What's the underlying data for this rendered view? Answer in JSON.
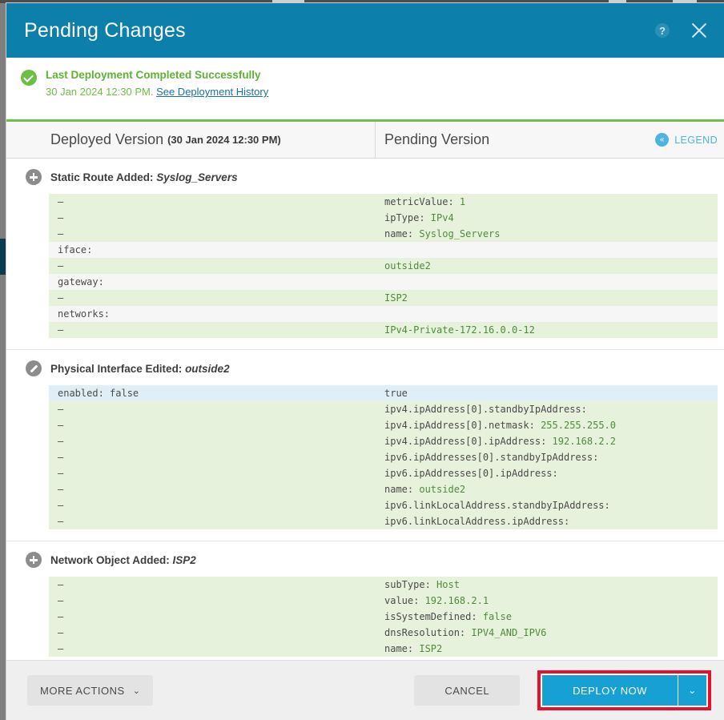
{
  "background": {
    "accent_blue": "#0d7fab",
    "success_green": "#6cbe45",
    "highlight_red": "#e8112d",
    "deploy_blue": "#17a0d4"
  },
  "titlebar": {
    "title": "Pending Changes",
    "help_icon": "help-circle-icon",
    "help_glyph": "?",
    "close_icon": "close-icon"
  },
  "banner": {
    "status_icon": "success-check-icon",
    "title": "Last Deployment Completed Successfully",
    "timestamp": "30 Jan 2024 12:30 PM.",
    "link_label": "See Deployment History"
  },
  "columns": {
    "deployed_label": "Deployed Version",
    "deployed_timestamp": "(30 Jan 2024 12:30 PM)",
    "pending_label": "Pending Version",
    "legend_label": "LEGEND",
    "legend_icon": "double-chevron-left-icon",
    "legend_glyph": "«"
  },
  "blocks": [
    {
      "icon": "plus-circle-icon",
      "icon_type": "plus",
      "title_prefix": "Static Route Added:",
      "title_name": "Syslog_Servers",
      "rows": [
        {
          "type": "added",
          "left": "–",
          "right_key": "metricValue:",
          "right_val": "1",
          "val_color": "green"
        },
        {
          "type": "added",
          "left": "–",
          "right_key": "ipType:",
          "right_val": "IPv4",
          "val_color": "green"
        },
        {
          "type": "added",
          "left": "–",
          "right_key": "name:",
          "right_val": "Syslog_Servers",
          "val_color": "green"
        },
        {
          "type": "neutral",
          "left": "iface:",
          "right_key": "",
          "right_val": "",
          "val_color": "green"
        },
        {
          "type": "added",
          "left": "–",
          "right_key": "",
          "right_val": "outside2",
          "val_color": "green"
        },
        {
          "type": "neutral",
          "left": "gateway:",
          "right_key": "",
          "right_val": "",
          "val_color": "green"
        },
        {
          "type": "added",
          "left": "–",
          "right_key": "",
          "right_val": "ISP2",
          "val_color": "green"
        },
        {
          "type": "neutral",
          "left": "networks:",
          "right_key": "",
          "right_val": "",
          "val_color": "green"
        },
        {
          "type": "added",
          "left": "–",
          "right_key": "",
          "right_val": "IPv4-Private-172.16.0.0-12",
          "val_color": "green"
        }
      ]
    },
    {
      "icon": "pencil-circle-icon",
      "icon_type": "pencil",
      "title_prefix": "Physical Interface Edited:",
      "title_name": "outside2",
      "rows": [
        {
          "type": "modified",
          "left_key": "enabled:",
          "left_val": "false",
          "right_key": "",
          "right_val": "true",
          "val_color": "dark"
        },
        {
          "type": "added",
          "left": "–",
          "right_key": "ipv4.ipAddress[0].standbyIpAddress:",
          "right_val": "",
          "val_color": "green"
        },
        {
          "type": "added",
          "left": "–",
          "right_key": "ipv4.ipAddress[0].netmask:",
          "right_val": "255.255.255.0",
          "val_color": "green"
        },
        {
          "type": "added",
          "left": "–",
          "right_key": "ipv4.ipAddress[0].ipAddress:",
          "right_val": "192.168.2.2",
          "val_color": "green"
        },
        {
          "type": "added",
          "left": "–",
          "right_key": "ipv6.ipAddresses[0].standbyIpAddress:",
          "right_val": "",
          "val_color": "green"
        },
        {
          "type": "added",
          "left": "–",
          "right_key": "ipv6.ipAddresses[0].ipAddress:",
          "right_val": "",
          "val_color": "green"
        },
        {
          "type": "added",
          "left": "–",
          "right_key": "name:",
          "right_val": "outside2",
          "val_color": "green"
        },
        {
          "type": "added",
          "left": "–",
          "right_key": "ipv6.linkLocalAddress.standbyIpAddress:",
          "right_val": "",
          "val_color": "green"
        },
        {
          "type": "added",
          "left": "–",
          "right_key": "ipv6.linkLocalAddress.ipAddress:",
          "right_val": "",
          "val_color": "green"
        }
      ]
    },
    {
      "icon": "plus-circle-icon",
      "icon_type": "plus",
      "title_prefix": "Network Object Added:",
      "title_name": "ISP2",
      "rows": [
        {
          "type": "added",
          "left": "–",
          "right_key": "subType:",
          "right_val": "Host",
          "val_color": "green"
        },
        {
          "type": "added",
          "left": "–",
          "right_key": "value:",
          "right_val": "192.168.2.1",
          "val_color": "green"
        },
        {
          "type": "added",
          "left": "–",
          "right_key": "isSystemDefined:",
          "right_val": "false",
          "val_color": "green"
        },
        {
          "type": "added",
          "left": "–",
          "right_key": "dnsResolution:",
          "right_val": "IPV4_AND_IPV6",
          "val_color": "green"
        },
        {
          "type": "added",
          "left": "–",
          "right_key": "name:",
          "right_val": "ISP2",
          "val_color": "green"
        }
      ]
    }
  ],
  "footer": {
    "more_actions_label": "MORE ACTIONS",
    "more_actions_caret": "⌄",
    "cancel_label": "CANCEL",
    "deploy_label": "DEPLOY NOW",
    "deploy_caret": "⌄"
  }
}
